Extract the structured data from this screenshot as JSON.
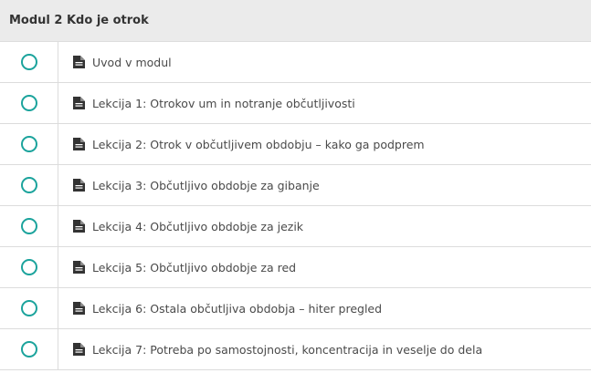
{
  "module": {
    "title": "Modul 2 Kdo je otrok"
  },
  "lessons": [
    {
      "title": "Uvod v modul",
      "status": "not-started",
      "icon": "document-icon"
    },
    {
      "title": "Lekcija 1: Otrokov um in notranje občutljivosti",
      "status": "not-started",
      "icon": "document-icon"
    },
    {
      "title": "Lekcija 2: Otrok v občutljivem obdobju – kako ga podprem",
      "status": "not-started",
      "icon": "document-icon"
    },
    {
      "title": "Lekcija 3: Občutljivo obdobje za gibanje",
      "status": "not-started",
      "icon": "document-icon"
    },
    {
      "title": "Lekcija 4: Občutljivo obdobje za jezik",
      "status": "not-started",
      "icon": "document-icon"
    },
    {
      "title": "Lekcija 5: Občutljivo obdobje za red",
      "status": "not-started",
      "icon": "document-icon"
    },
    {
      "title": "Lekcija 6: Ostala občutljiva obdobja – hiter pregled",
      "status": "not-started",
      "icon": "document-icon"
    },
    {
      "title": "Lekcija 7: Potreba po samostojnosti, koncentracija in veselje do dela",
      "status": "not-started",
      "icon": "document-icon"
    }
  ],
  "colors": {
    "status_circle": "#1ba39c",
    "header_bg": "#ebebeb"
  }
}
